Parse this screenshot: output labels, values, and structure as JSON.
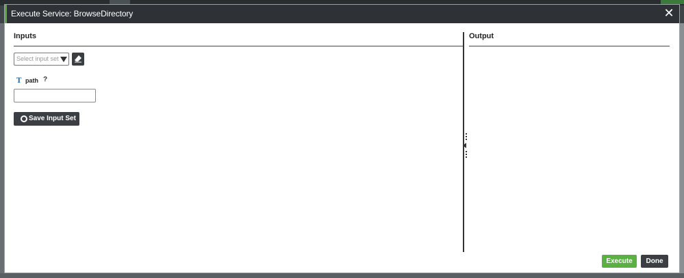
{
  "dialog": {
    "title": "Execute Service: BrowseDirectory",
    "close_icon": "close-icon",
    "accent_color": "#5aa942"
  },
  "inputs": {
    "heading": "Inputs",
    "input_set_placeholder": "Select input set",
    "clear_icon": "eraser-icon",
    "parameter": {
      "type_icon": "string-type-icon",
      "name": "path",
      "help": "?",
      "value": ""
    },
    "save_label": "Save Input Set"
  },
  "output": {
    "heading": "Output"
  },
  "footer": {
    "execute_label": "Execute",
    "done_label": "Done"
  },
  "colors": {
    "header_bg": "#2e3236",
    "execute_bg": "#5ab043",
    "dark_button_bg": "#3b3f43"
  }
}
